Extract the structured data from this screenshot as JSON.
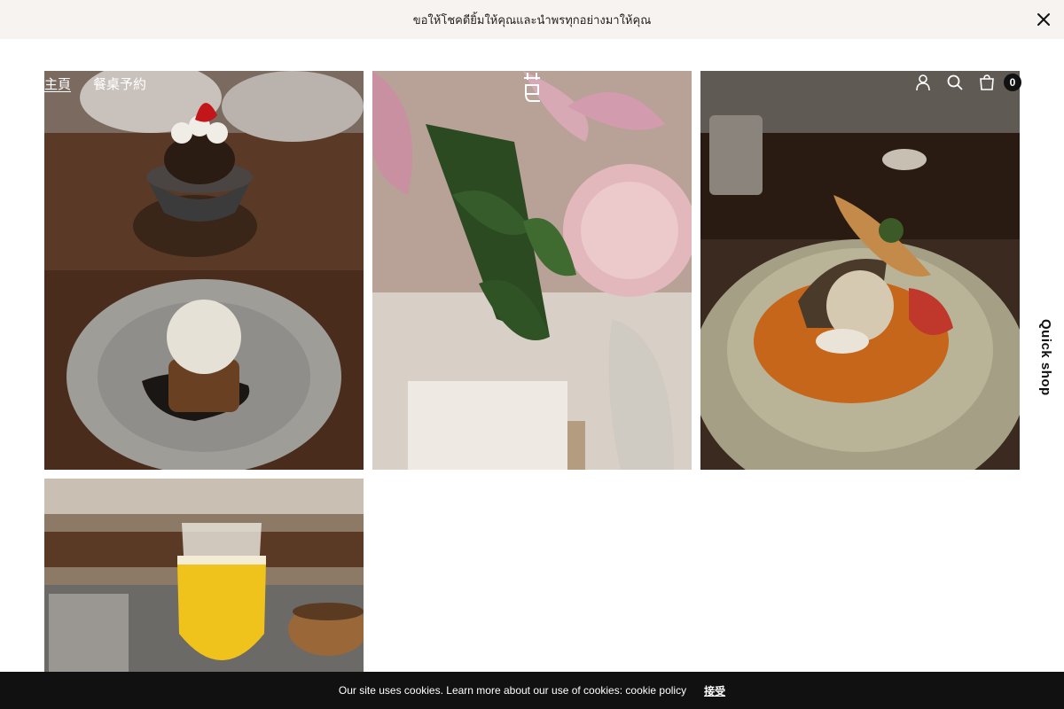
{
  "announcement": {
    "text": "ขอให้โชคดียิ้มให้คุณและนำพรทุกอย่างมาให้คุณ"
  },
  "nav": {
    "items": [
      {
        "label": "主頁",
        "active": true
      },
      {
        "label": "餐桌予約",
        "active": false
      }
    ]
  },
  "header": {
    "cart_count": "0"
  },
  "quick_shop": {
    "label": "Quick shop"
  },
  "cookie_bar": {
    "text": "Our site uses cookies. Learn more about our use of cookies: cookie policy",
    "accept_label": "接受"
  },
  "colors": {
    "announcement_bg": "#f7f3f1",
    "cookie_bg": "#111111",
    "cart_badge": "#111111"
  },
  "icons": {
    "close": "close-icon",
    "account": "user-icon",
    "search": "search-icon",
    "cart": "shopping-bag-icon"
  }
}
